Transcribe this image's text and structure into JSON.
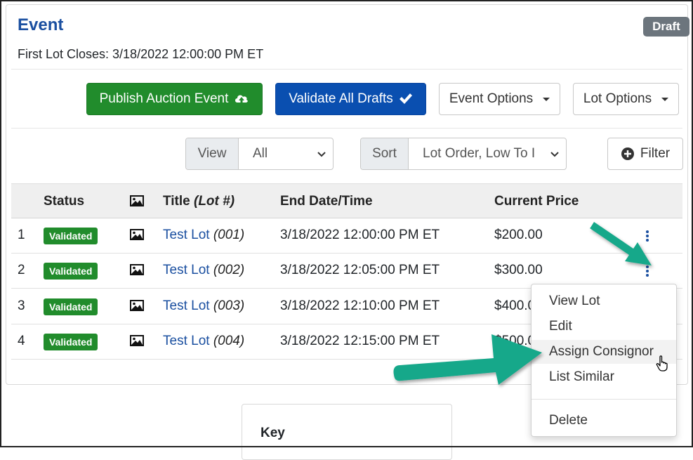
{
  "event": {
    "title": "Event",
    "status_badge": "Draft",
    "first_lot_closes": "First Lot Closes: 3/18/2022 12:00:00 PM ET"
  },
  "toolbar": {
    "publish_label": "Publish Auction Event",
    "validate_label": "Validate All Drafts",
    "event_options_label": "Event Options",
    "lot_options_label": "Lot Options"
  },
  "filters": {
    "view_label": "View",
    "view_value": "All",
    "sort_label": "Sort",
    "sort_value": "Lot Order, Low To I",
    "filter_label": "Filter"
  },
  "table": {
    "headers": {
      "status": "Status",
      "title": "Title",
      "lot_hash": "(Lot #)",
      "end": "End Date/Time",
      "price": "Current Price"
    },
    "rows": [
      {
        "num": "1",
        "status": "Validated",
        "title": "Test Lot",
        "lot": "(001)",
        "end": "3/18/2022 12:00:00 PM ET",
        "price": "$200.00"
      },
      {
        "num": "2",
        "status": "Validated",
        "title": "Test Lot",
        "lot": "(002)",
        "end": "3/18/2022 12:05:00 PM ET",
        "price": "$300.00"
      },
      {
        "num": "3",
        "status": "Validated",
        "title": "Test Lot",
        "lot": "(003)",
        "end": "3/18/2022 12:10:00 PM ET",
        "price": "$400.0"
      },
      {
        "num": "4",
        "status": "Validated",
        "title": "Test Lot",
        "lot": "(004)",
        "end": "3/18/2022 12:15:00 PM ET",
        "price": "$500.0"
      }
    ]
  },
  "dropdown": {
    "items": [
      "View Lot",
      "Edit",
      "Assign Consignor",
      "List Similar",
      "Delete"
    ]
  },
  "key": {
    "title": "Key"
  },
  "colors": {
    "brand_blue": "#1a4fa0",
    "success_green": "#218c2c",
    "primary_blue": "#0a4fb0",
    "annotation_arrow": "#14a88a"
  }
}
